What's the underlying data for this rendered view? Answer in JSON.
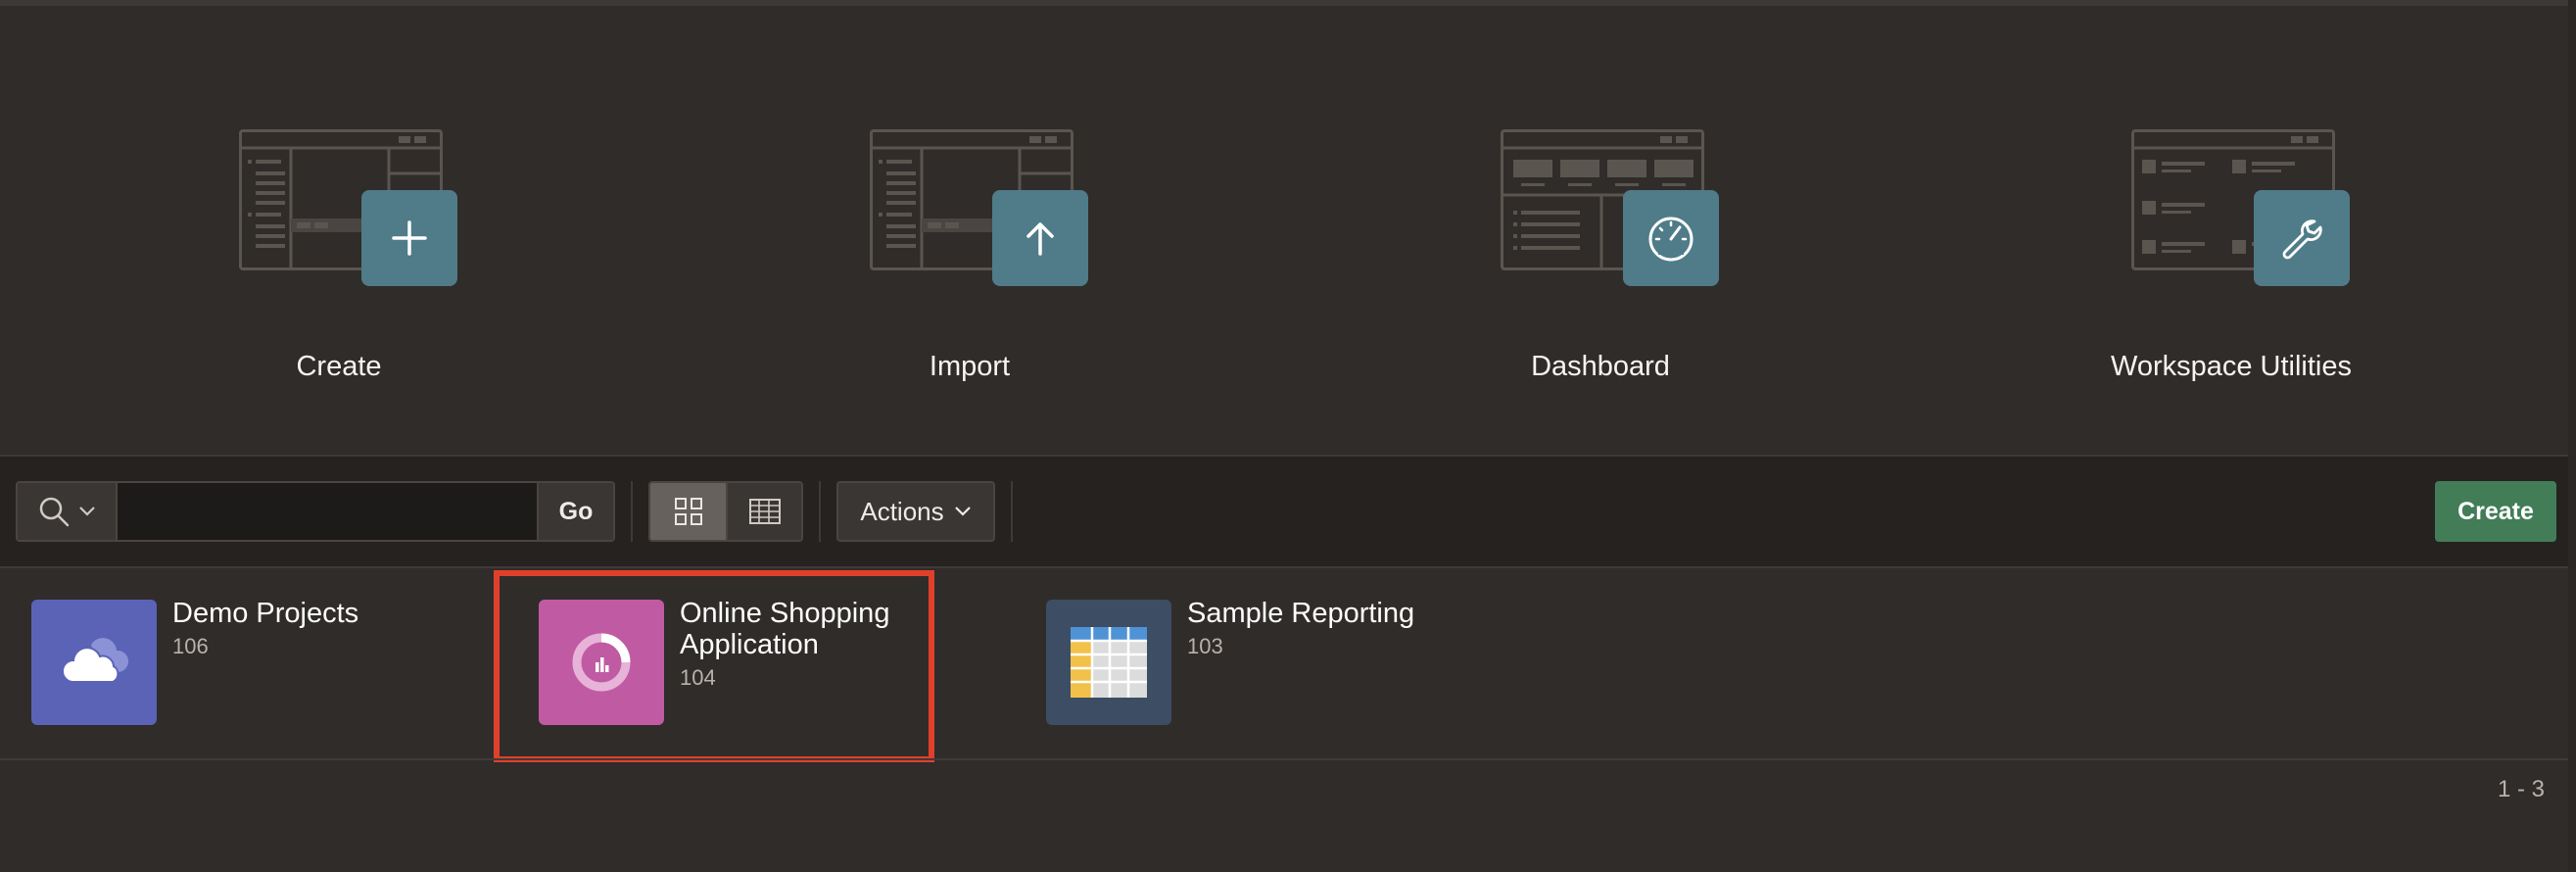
{
  "hero_tiles": [
    {
      "label": "Create",
      "icon": "plus-icon"
    },
    {
      "label": "Import",
      "icon": "upload-arrow-icon"
    },
    {
      "label": "Dashboard",
      "icon": "gauge-icon"
    },
    {
      "label": "Workspace Utilities",
      "icon": "wrench-icon"
    }
  ],
  "toolbar": {
    "search_value": "",
    "go_label": "Go",
    "actions_label": "Actions",
    "create_label": "Create"
  },
  "apps": [
    {
      "name": "Demo Projects",
      "id": "106",
      "icon": "cloud-icon",
      "color": "#5b63b7"
    },
    {
      "name": "Online Shopping Application",
      "id": "104",
      "icon": "donut-chart-icon",
      "color": "#c05ba3"
    },
    {
      "name": "Sample Reporting",
      "id": "103",
      "icon": "table-icon",
      "color": "#3c4d64"
    }
  ],
  "pagination": "1 - 3",
  "colors": {
    "background": "#302c29",
    "toolbar": "#252220",
    "accent_badge": "#4f7c88",
    "create_button": "#427d57",
    "highlight_border": "#e0402b"
  }
}
